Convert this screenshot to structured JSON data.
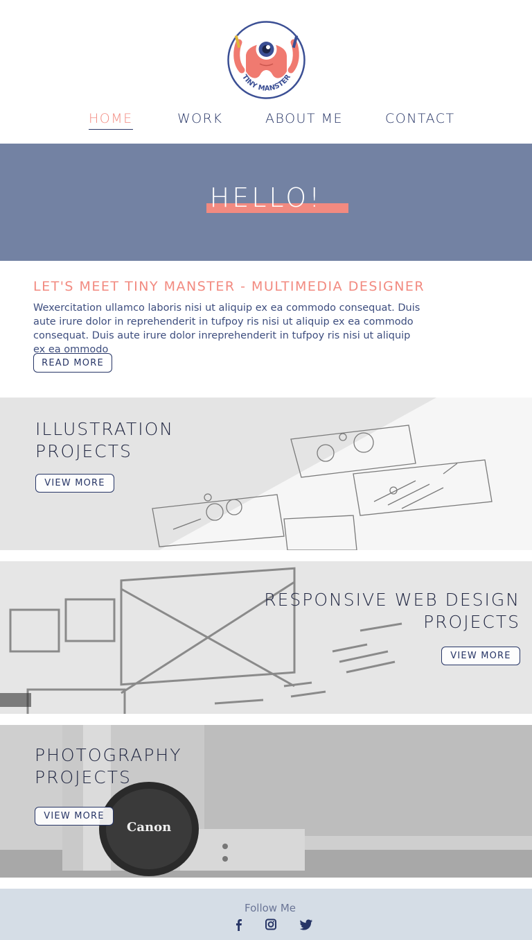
{
  "brand": {
    "logo_text": "TINY MANSTER"
  },
  "nav": {
    "items": [
      {
        "label": "HOME",
        "active": true
      },
      {
        "label": "WORK",
        "active": false
      },
      {
        "label": "ABOUT ME",
        "active": false
      },
      {
        "label": "CONTACT",
        "active": false
      }
    ]
  },
  "hero": {
    "title": "HELLO!"
  },
  "intro": {
    "heading": "LET'S MEET TINY MANSTER - MULTIMEDIA DESIGNER",
    "text": "Wexercitation ullamco laboris nisi ut aliquip ex ea commodo consequat. Duis  aute irure dolor in reprehenderit in tufpoy ris nisi ut aliquip ex ea commodo consequat. Duis aute irure dolor inreprehenderit in tufpoy ris nisi ut aliquip ex ea ommodo",
    "button": "READ MORE"
  },
  "projects": [
    {
      "title_line1": "ILLUSTRATION",
      "title_line2": "PROJECTS",
      "button": "VIEW MORE"
    },
    {
      "title_line1": "RESPONSIVE WEB DESIGN",
      "title_line2": "PROJECTS",
      "button": "VIEW MORE"
    },
    {
      "title_line1": "PHOTOGRAPHY",
      "title_line2": "PROJECTS",
      "button": "VIEW MORE",
      "photo_text": "Canon"
    }
  ],
  "footer": {
    "follow_label": "Follow Me",
    "social_icons": [
      "facebook-icon",
      "instagram-icon",
      "twitter-icon"
    ]
  },
  "colors": {
    "accent": "#f28a80",
    "navy": "#273566",
    "hero_bg": "#7382a3",
    "footer_bg": "#d5dde6"
  }
}
